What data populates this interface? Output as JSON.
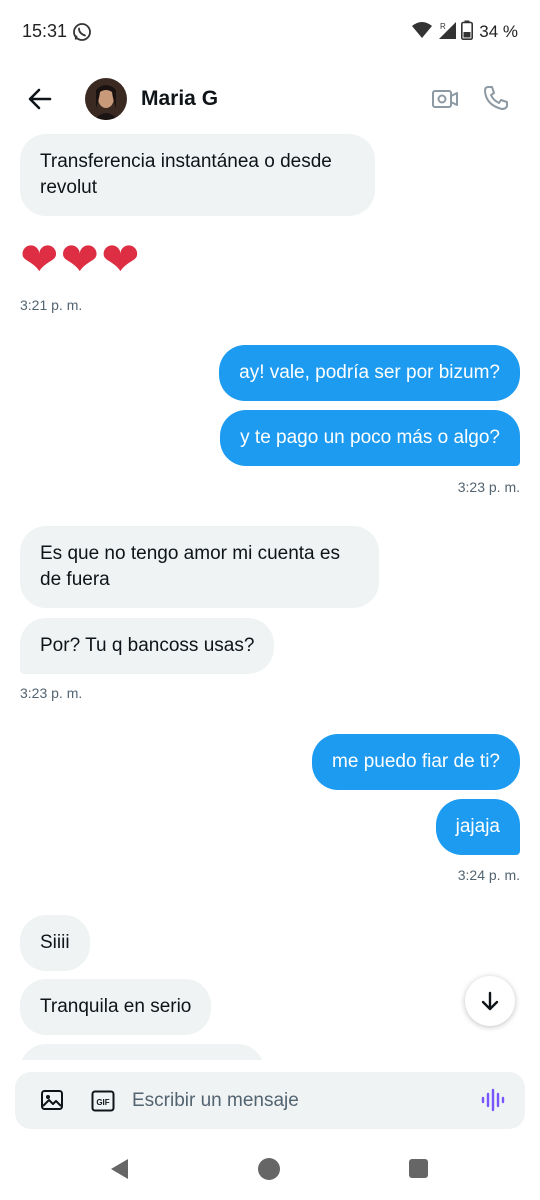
{
  "status_bar": {
    "time": "15:31",
    "battery": "34 %",
    "icons": [
      "whatsapp-icon",
      "wifi-icon",
      "signal-icon",
      "battery-icon"
    ]
  },
  "header": {
    "contact_name": "Maria G",
    "icons": [
      "back-arrow-icon",
      "video-call-icon",
      "phone-call-icon"
    ]
  },
  "messages": [
    {
      "dir": "in",
      "text": "Transferencia instantánea o desde revolut"
    },
    {
      "dir": "in",
      "emoji": "❤❤❤"
    },
    {
      "dir": "out",
      "text": "ay! vale, podría ser por bizum?"
    },
    {
      "dir": "out",
      "text": "y te pago un poco más o algo?"
    },
    {
      "dir": "in",
      "text": "Es que no tengo amor mi cuenta es de fuera"
    },
    {
      "dir": "in",
      "text": "Por? Tu q bancoss usas?"
    },
    {
      "dir": "out",
      "text": "me puedo fiar de ti?"
    },
    {
      "dir": "out",
      "text": "jajaja"
    },
    {
      "dir": "in",
      "text": "Siiii"
    },
    {
      "dir": "in",
      "text": "Tranquila en serio"
    }
  ],
  "timestamps": [
    "3:21 p. m.",
    "3:23 p. m.",
    "3:23 p. m.",
    "3:24 p. m."
  ],
  "composer": {
    "placeholder": "Escribir un mensaje",
    "gif_label": "GIF"
  },
  "colors": {
    "outgoing_bubble": "#1d9bf0",
    "incoming_bubble": "#eff3f4",
    "voice_icon": "#7856ff",
    "heart": "#dd2e44"
  }
}
